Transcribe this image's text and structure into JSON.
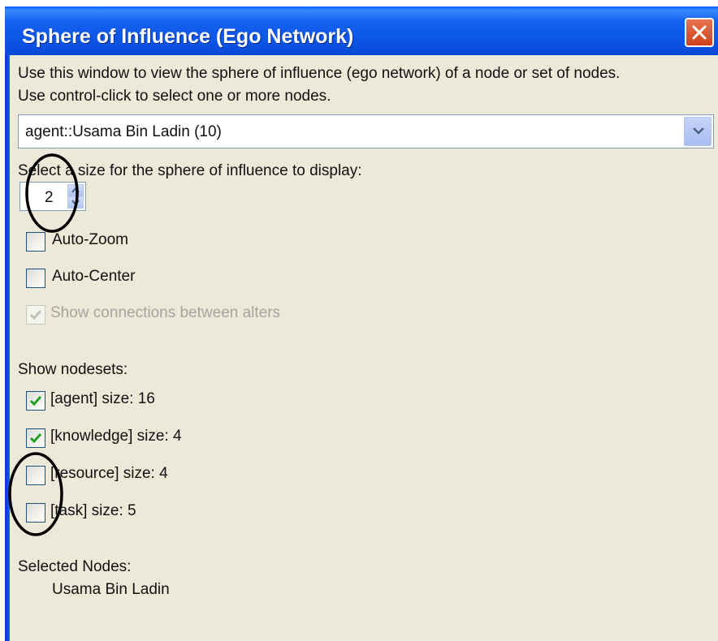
{
  "window": {
    "title": "Sphere of Influence (Ego Network)",
    "title_bar_color": "#0a5ffe",
    "background": "#ece9d8"
  },
  "intro": {
    "line1": "Use this window to view the sphere of influence (ego network) of a node or set of nodes.",
    "line2": "Use control-click to select one or more nodes."
  },
  "node_select": {
    "value": "agent::Usama Bin Ladin (10)"
  },
  "size": {
    "label": "Select a size for the sphere of influence to display:",
    "value": "2"
  },
  "options": [
    {
      "label": "Auto-Zoom",
      "checked": false,
      "enabled": true
    },
    {
      "label": "Auto-Center",
      "checked": false,
      "enabled": true
    },
    {
      "label": "Show connections between alters",
      "checked": true,
      "enabled": false
    }
  ],
  "nodesets": {
    "heading": "Show nodesets:",
    "items": [
      {
        "label": "[agent] size: 16",
        "checked": true
      },
      {
        "label": "[knowledge] size: 4",
        "checked": true
      },
      {
        "label": "[resource] size: 4",
        "checked": false
      },
      {
        "label": "[task] size: 5",
        "checked": false
      }
    ]
  },
  "selected": {
    "heading": "Selected Nodes:",
    "value": "Usama Bin Ladin"
  },
  "icons": {
    "close": "close-icon",
    "dropdown": "chevron-down-icon",
    "spin_up": "spin-up-icon",
    "spin_down": "spin-down-icon",
    "check": "checkmark-icon"
  }
}
